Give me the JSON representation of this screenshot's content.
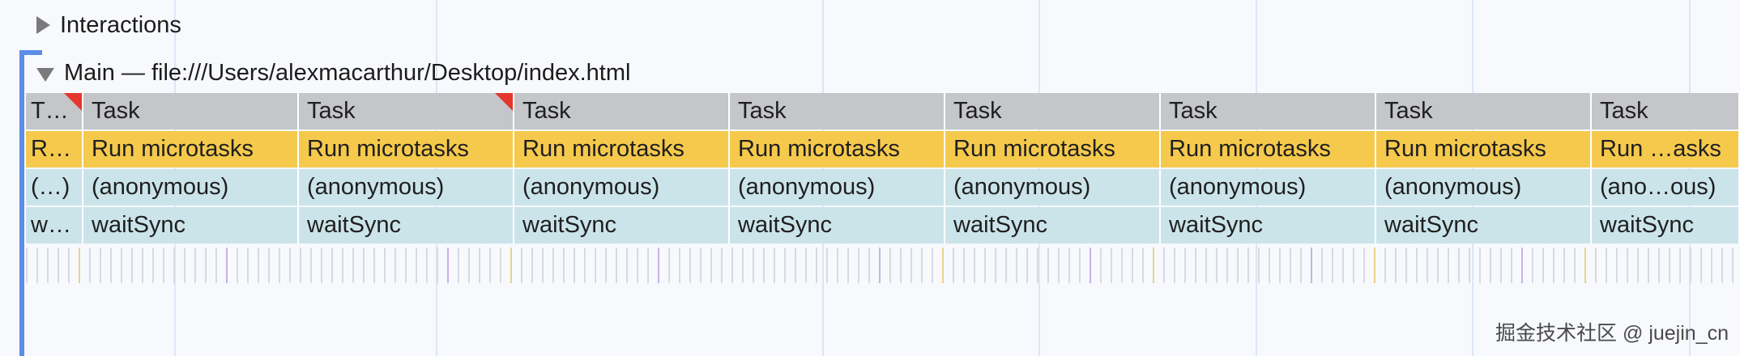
{
  "tracks": {
    "interactions": {
      "label": "Interactions"
    },
    "main": {
      "label": "Main — file:///Users/alexmacarthur/Desktop/index.html"
    }
  },
  "flame_chart": {
    "task_row": [
      "T…",
      "Task",
      "Task",
      "Task",
      "Task",
      "Task",
      "Task",
      "Task",
      "Task"
    ],
    "microtask_row": [
      "R…",
      "Run microtasks",
      "Run microtasks",
      "Run microtasks",
      "Run microtasks",
      "Run microtasks",
      "Run microtasks",
      "Run microtasks",
      "Run …asks"
    ],
    "anonymous_row": [
      "(…)",
      "(anonymous)",
      "(anonymous)",
      "(anonymous)",
      "(anonymous)",
      "(anonymous)",
      "(anonymous)",
      "(anonymous)",
      "(ano…ous)"
    ],
    "waitsync_row": [
      "w…",
      "waitSync",
      "waitSync",
      "waitSync",
      "waitSync",
      "waitSync",
      "waitSync",
      "waitSync",
      "waitSync"
    ],
    "long_task_flags": [
      true,
      false,
      true,
      false,
      false,
      false,
      false,
      false,
      false
    ]
  },
  "watermark": "掘金技术社区 @ juejin_cn",
  "colors": {
    "task": "#c4c6c9",
    "microtasks": "#f5c94c",
    "function": "#cbe4ea",
    "long_task_marker": "#e5362d",
    "track_accent": "#5b8ee6"
  },
  "icons": {
    "interactions_toggle": "triangle-right-icon",
    "main_toggle": "triangle-down-icon"
  }
}
